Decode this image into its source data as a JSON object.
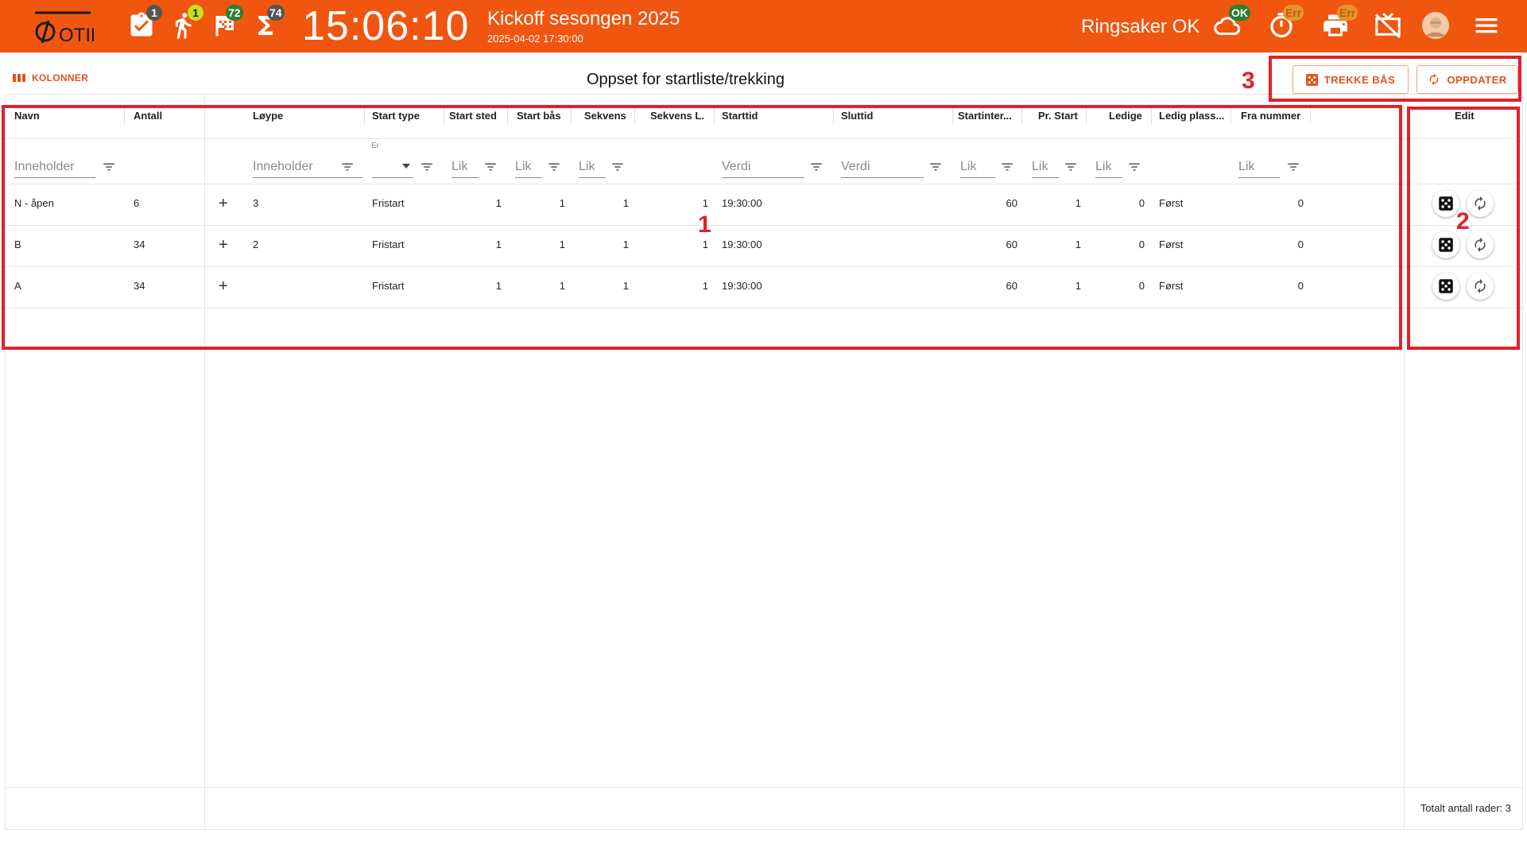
{
  "topbar": {
    "logo_text": "OTID",
    "badges": {
      "tasks": "1",
      "runners": "1",
      "finish": "72",
      "total": "74"
    },
    "clock": "15:06:10",
    "event_title": "Kickoff sesongen 2025",
    "event_datetime": "2025-04-02 17:30:00",
    "club": "Ringsaker OK",
    "status_badges": {
      "cloud": "OK",
      "timer": "Err",
      "printer": "Err"
    },
    "colors": {
      "bar": "#f0560f",
      "badge_dark": "#555555",
      "badge_green": "#2e7d32",
      "badge_yellow": "#c6e01a",
      "badge_err": "#e8932a"
    }
  },
  "toolbar": {
    "columns_label": "KOLONNER",
    "page_title": "Oppset for startliste/trekking",
    "draw_button": "TREKKE BÅS",
    "refresh_button": "OPPDATER"
  },
  "grid": {
    "headers": {
      "navn": "Navn",
      "antall": "Antall",
      "loype": "Løype",
      "start_type": "Start type",
      "start_sted": "Start sted",
      "start_bas": "Start bås",
      "sekvens": "Sekvens",
      "sekvens_l": "Sekvens L.",
      "starttid": "Starttid",
      "sluttid": "Sluttid",
      "startinterval": "Startinter...",
      "pr_start": "Pr. Start",
      "ledige": "Ledige",
      "ledig_plass": "Ledig plass...",
      "fra_nummer": "Fra nummer",
      "edit": "Edit"
    },
    "filters": {
      "contains": "Inneholder",
      "equals": "Lik",
      "value": "Verdi",
      "is_label": "Er"
    },
    "rows": [
      {
        "navn": "N - åpen",
        "antall": "6",
        "loype": "3",
        "start_type": "Fristart",
        "start_sted": "1",
        "start_bas": "1",
        "sekvens": "1",
        "sekvens_l": "1",
        "starttid": "19:30:00",
        "sluttid": "",
        "startinterval": "60",
        "pr_start": "1",
        "ledige": "0",
        "ledig_plass": "Først",
        "fra_nummer": "0"
      },
      {
        "navn": "B",
        "antall": "34",
        "loype": "2",
        "start_type": "Fristart",
        "start_sted": "1",
        "start_bas": "1",
        "sekvens": "1",
        "sekvens_l": "1",
        "starttid": "19:30:00",
        "sluttid": "",
        "startinterval": "60",
        "pr_start": "1",
        "ledige": "0",
        "ledig_plass": "Først",
        "fra_nummer": "0"
      },
      {
        "navn": "A",
        "antall": "34",
        "loype": "",
        "start_type": "Fristart",
        "start_sted": "1",
        "start_bas": "1",
        "sekvens": "1",
        "sekvens_l": "1",
        "starttid": "19:30:00",
        "sluttid": "",
        "startinterval": "60",
        "pr_start": "1",
        "ledige": "0",
        "ledig_plass": "Først",
        "fra_nummer": "0"
      }
    ],
    "total_rows": "Totalt antall rader: 3"
  },
  "annotations": {
    "one": "1",
    "two": "2",
    "three": "3",
    "color": "#e3202a"
  }
}
